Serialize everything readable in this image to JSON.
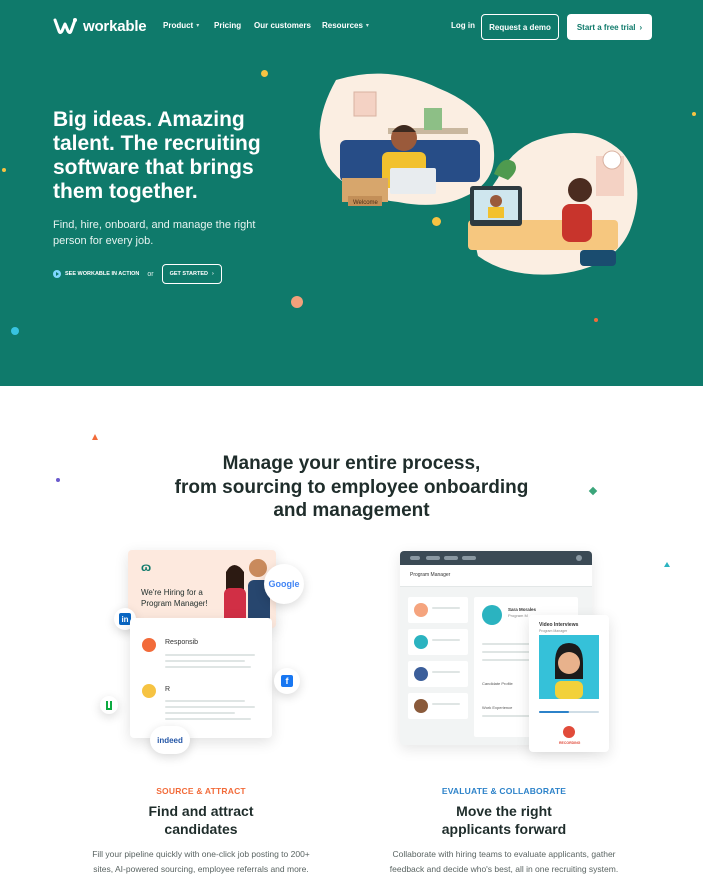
{
  "nav": {
    "logo_text": "workable",
    "links": [
      "Product",
      "Pricing",
      "Our customers",
      "Resources"
    ],
    "login": "Log in",
    "demo": "Request a demo",
    "trial": "Start a free trial"
  },
  "hero": {
    "title": "Big ideas. Amazing talent. The recruiting software that brings them together.",
    "subtitle": "Find, hire, onboard, and manage the right person for every job.",
    "see_action": "SEE WORKABLE IN ACTION",
    "or": "or",
    "get_started": "GET STARTED",
    "welcome_mat": "Welcome"
  },
  "process": {
    "title_lines": [
      "Manage your entire process,",
      "from sourcing to employee onboarding",
      "and management"
    ]
  },
  "source": {
    "eyebrow": "SOURCE & ATTRACT",
    "title_lines": [
      "Find and attract",
      "candidates"
    ],
    "desc_lines": [
      "Fill your pipeline quickly with one-click job posting to 200+",
      "sites, AI-powered sourcing, employee referrals and more."
    ],
    "card_heading_lines": [
      "We're Hiring for a",
      "Program Manager!"
    ],
    "google": "Google",
    "indeed": "indeed",
    "resp": "Responsib",
    "req": "R"
  },
  "evaluate": {
    "eyebrow": "EVALUATE & COLLABORATE",
    "title_lines": [
      "Move the right",
      "applicants forward"
    ],
    "desc_lines": [
      "Collaborate with hiring teams to evaluate applicants, gather",
      "feedback and decide who's best, all in one recruiting system."
    ],
    "window_title": "Program Manager",
    "candidate_name": "Sara Morales",
    "candidate_role": "Program M",
    "video_title": "Video Interviews",
    "video_sub": "Program Manager",
    "profile_label": "Candidate Profile",
    "experience_label": "Work Experience",
    "recording": "RECORDING"
  },
  "colors": {
    "hero_bg": "#0f7a6b",
    "accent_orange": "#f26b3a",
    "accent_blue": "#2c82c9"
  }
}
